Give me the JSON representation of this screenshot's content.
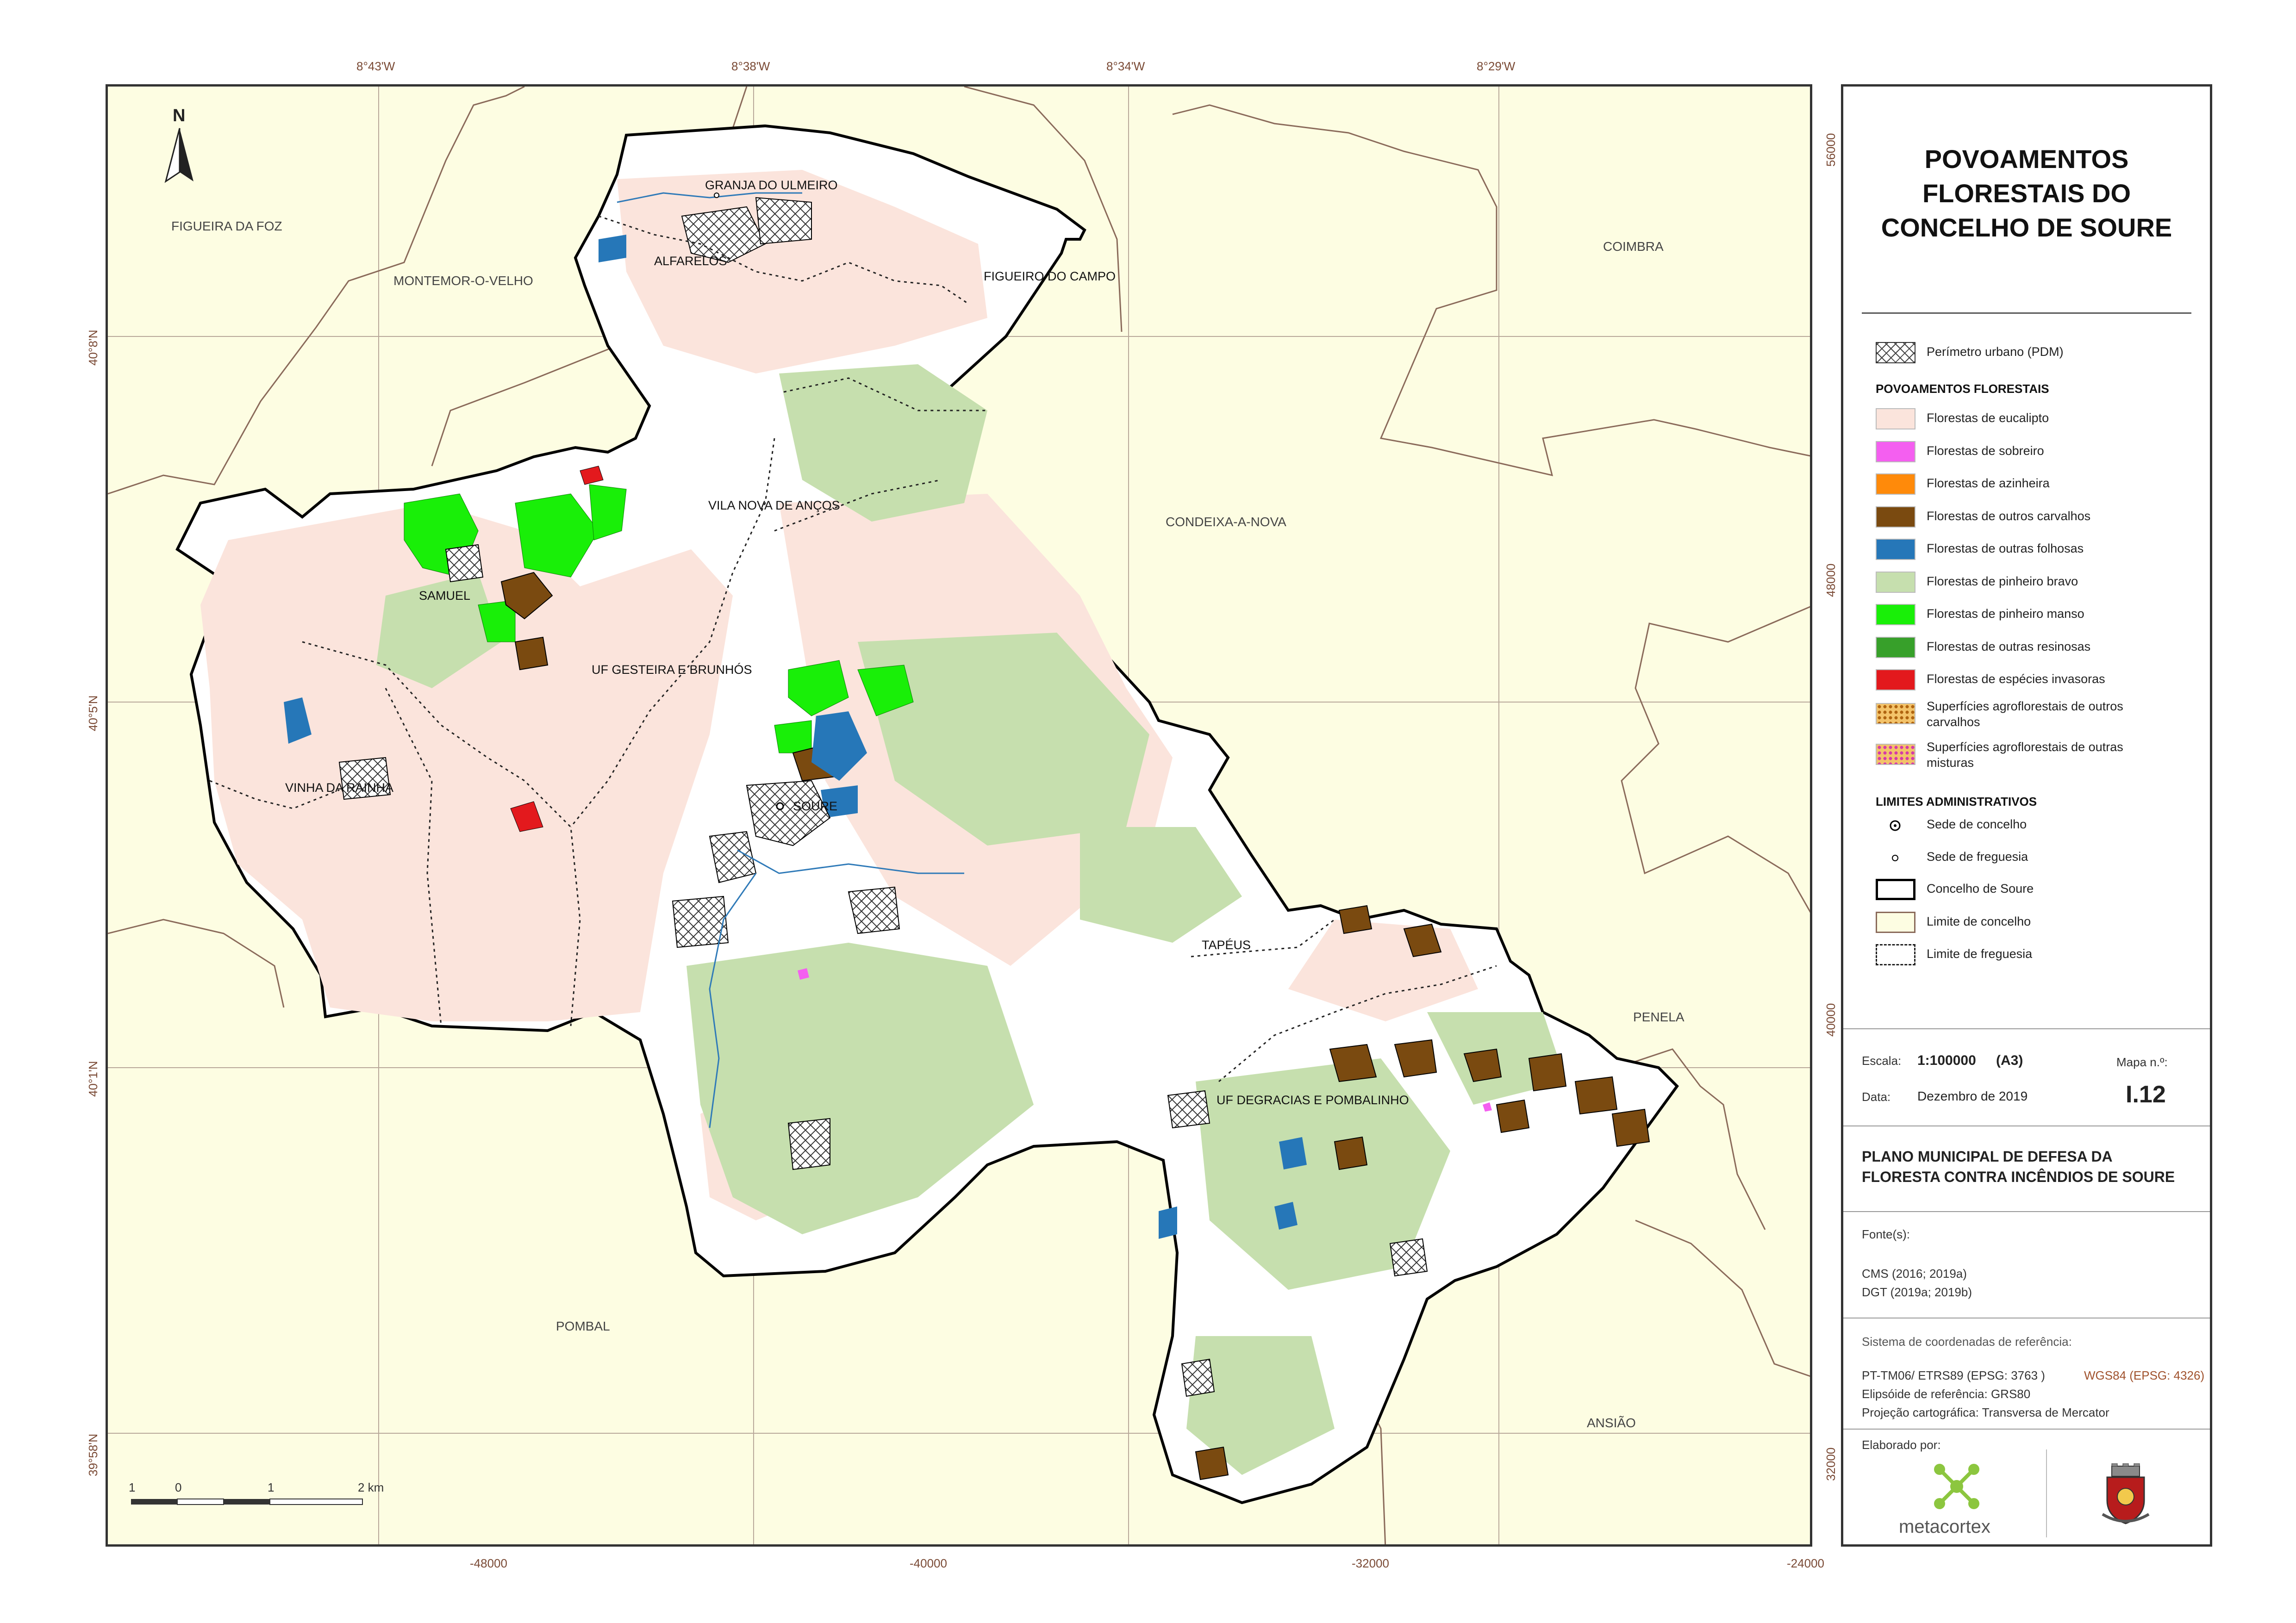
{
  "map": {
    "top_coords": [
      "8°43'W",
      "8°38'W",
      "8°34'W",
      "8°29'W"
    ],
    "bottom_coords": [
      "-48000",
      "-40000",
      "-32000",
      "-24000"
    ],
    "left_coords": [
      "40°8'N",
      "40°5'N",
      "40°1'N",
      "39°58'N"
    ],
    "right_coords": [
      "56000",
      "48000",
      "40000",
      "32000"
    ],
    "north_label": "N",
    "neighbors": [
      "FIGUEIRA DA FOZ",
      "MONTEMOR-O-VELHO",
      "COIMBRA",
      "CONDEIXA-A-NOVA",
      "PENELA",
      "POMBAL",
      "ANSIÃO"
    ],
    "towns": [
      "GRANJA DO ULMEIRO",
      "ALFARELOS",
      "FIGUEIRO DO CAMPO",
      "VILA NOVA DE ANÇOS",
      "SAMUEL",
      "UF GESTEIRA E BRUNHÓS",
      "VINHA DA RAINHA",
      "SOURE",
      "TAPÉUS",
      "UF DEGRACIAS E POMBALINHO"
    ],
    "scalebar": [
      "1",
      "0",
      "1",
      "2 km"
    ]
  },
  "legend": {
    "title": [
      "POVOAMENTOS",
      "FLORESTAIS DO",
      "CONCELHO DE SOURE"
    ],
    "urban": "Perímetro urbano (PDM)",
    "forest_header": "POVOAMENTOS FLORESTAIS",
    "forest_items": [
      {
        "label": "Florestas de eucalipto",
        "color": "#fbe4dc"
      },
      {
        "label": "Florestas de sobreiro",
        "color": "#f45ff0"
      },
      {
        "label": "Florestas de azinheira",
        "color": "#ff8a0a"
      },
      {
        "label": "Florestas de outros carvalhos",
        "color": "#7a4a10"
      },
      {
        "label": "Florestas de outras folhosas",
        "color": "#2677b8"
      },
      {
        "label": "Florestas de pinheiro bravo",
        "color": "#c6dfae"
      },
      {
        "label": "Florestas de pinheiro manso",
        "color": "#19ef08"
      },
      {
        "label": "Florestas de outras resinosas",
        "color": "#37a02a"
      },
      {
        "label": "Florestas de espécies invasoras",
        "color": "#e3191d"
      }
    ],
    "agro_items": [
      {
        "label": [
          "Superfícies agroflorestais de outros",
          "carvalhos"
        ],
        "color": "#b06410"
      },
      {
        "label": [
          "Superfícies agroflorestais de outras",
          "misturas"
        ],
        "color": "#d63aa8"
      }
    ],
    "limits_header": "LIMITES ADMINISTRATIVOS",
    "limits_items": [
      "Sede de concelho",
      "Sede de freguesia",
      "Concelho de Soure",
      "Limite de concelho",
      "Limite de freguesia"
    ],
    "scale_label": "Escala:",
    "scale_value": "1:100000",
    "scale_paper": "(A3)",
    "map_no_label": "Mapa n.º:",
    "map_no": "I.12",
    "date_label": "Data:",
    "date_value": "Dezembro de 2019",
    "plan": [
      "PLANO MUNICIPAL DE DEFESA DA",
      "FLORESTA CONTRA INCÊNDIOS DE SOURE"
    ],
    "sources_label": "Fonte(s):",
    "sources": [
      "CMS (2016; 2019a)",
      "DGT (2019a; 2019b)"
    ],
    "crs_label": "Sistema de coordenadas de referência:",
    "crs_main": "PT-TM06/ ETRS89 (EPSG: 3763 )",
    "crs_alt": "WGS84 (EPSG: 4326)",
    "ellipsoid": "Elipsóide de referência: GRS80",
    "projection": "Projeção cartográfica: Transversa de Mercator",
    "author_label": "Elaborado por:",
    "company": "metacortex"
  }
}
